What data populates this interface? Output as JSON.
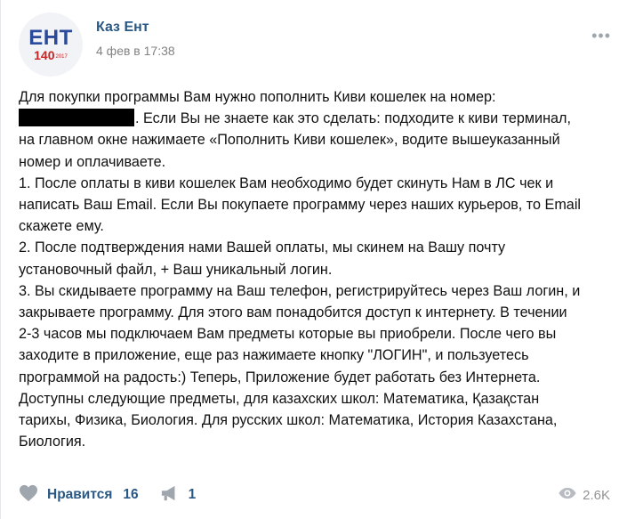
{
  "post": {
    "avatar": {
      "logo_text": "ЕНТ",
      "logo_number": "140",
      "logo_year": "2017"
    },
    "author": "Каз Ент",
    "date": "4 фев в 17:38",
    "text": {
      "p1_line1": "Для покупки программы Вам нужно пополнить Киви кошелек на номер:",
      "p1_after_redacted": ". Если Вы не знаете как это сделать: подходите к киви терминал,",
      "p1_line3": "на главном окне нажимаете «Пополнить Киви кошелек», водите вышеуказанный",
      "p1_line4": "номер и оплачиваете.",
      "p2_line1": "1. После оплаты в киви кошелек Вам необходимо будет скинуть Нам в ЛС чек и",
      "p2_line2": "написать Ваш Email. Если Вы покупаете программу через наших курьеров, то Email",
      "p2_line3": "скажете ему.",
      "p3_line1": "2. После подтверждения нами Вашей оплаты, мы скинем на Вашу почту",
      "p3_line2": "установочный файл, + Ваш уникальный логин.",
      "p4_line1": "3. Вы скидываете программу на Ваш телефон, регистрируйтесь через Ваш логин, и",
      "p4_line2": "закрываете программу. Для этого вам понадобится доступ к интернету. В течении",
      "p4_line3": "2-3 часов мы подключаем Вам предметы которые вы приобрели. После чего вы",
      "p4_line4": "заходите в приложение, еще раз нажимаете кнопку \"ЛОГИН\", и пользуетесь",
      "p4_line5": "программой на радость:) Теперь, Приложение будет работать без Интернета.",
      "p5_line1": "Доступны следующие предметы, для казахских школ: Математика, Қазақстан",
      "p5_line2": "тарихы, Физика, Биология. Для русских школ: Математика, История Казахстана,",
      "p5_line3": "Биология."
    },
    "actions": {
      "like_label": "Нравится",
      "like_count": "16",
      "share_count": "1",
      "views_count": "2.6K"
    },
    "colors": {
      "link": "#2a5885",
      "muted": "#828282",
      "icon": "#a0a6ae"
    }
  }
}
